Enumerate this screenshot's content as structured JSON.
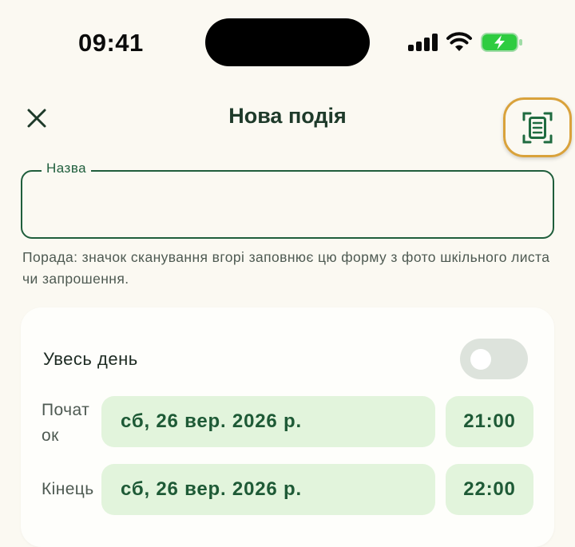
{
  "status_bar": {
    "time": "09:41",
    "icons": [
      "cellular-signal-icon",
      "wifi-icon",
      "battery-charging-icon"
    ],
    "battery_color": "#2ecc40"
  },
  "header": {
    "title": "Нова подія",
    "close_icon": "close-icon",
    "scan_icon": "document-scan-icon"
  },
  "form": {
    "name_label": "Назва",
    "name_value": "",
    "hint": "Порада: значок сканування вгорі заповнює цю форму з фото шкільного листа чи запрошення."
  },
  "schedule": {
    "all_day_label": "Увесь день",
    "all_day_on": false,
    "start_label": "Почат\nок",
    "start_date": "сб, 26 вер. 2026 р.",
    "start_time": "21:00",
    "end_label": "Кінець",
    "end_date": "сб, 26 вер. 2026 р.",
    "end_time": "22:00"
  },
  "colors": {
    "primary": "#1f5e3c",
    "accent_highlight": "#d9a23b",
    "pill_bg": "#e2f4dc",
    "background": "#fbf9f2"
  }
}
